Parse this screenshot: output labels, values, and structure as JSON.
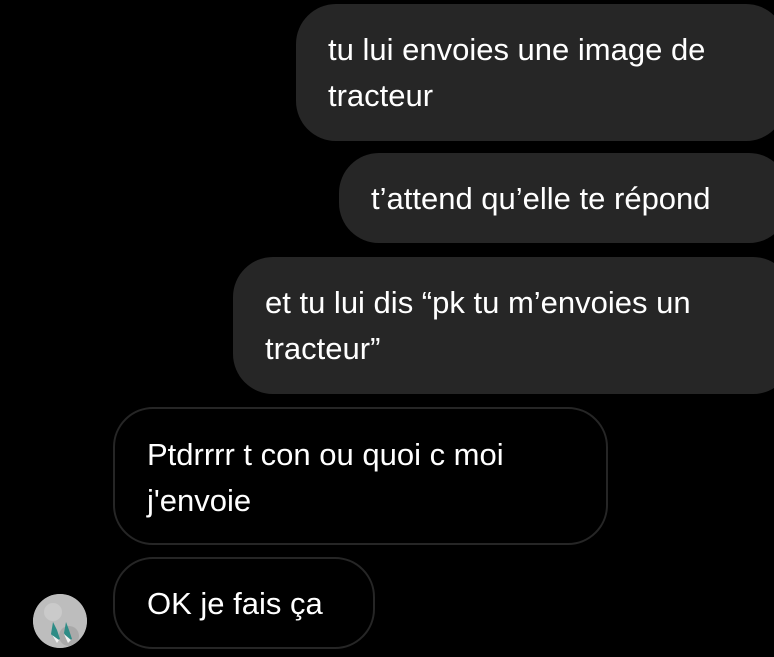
{
  "conversation": {
    "messages": [
      {
        "direction": "sent",
        "text": "tu lui envoies une image de\ntracteur"
      },
      {
        "direction": "sent",
        "text": "t’attend qu’elle te répond"
      },
      {
        "direction": "sent",
        "text": "et tu lui dis “pk tu m’envoies un\ntracteur”"
      },
      {
        "direction": "received",
        "text": "Ptdrrrr t con ou quoi c moi\nj'envoie"
      },
      {
        "direction": "received",
        "text": "OK je fais ça"
      }
    ]
  },
  "colors": {
    "background": "#000000",
    "sent_bubble": "#262626",
    "received_border": "#262626",
    "text": "#ffffff"
  }
}
